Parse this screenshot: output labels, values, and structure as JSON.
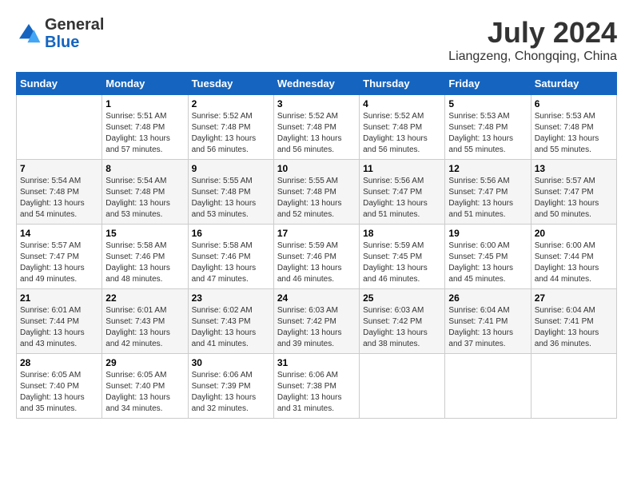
{
  "header": {
    "logo_line1": "General",
    "logo_line2": "Blue",
    "month": "July 2024",
    "location": "Liangzeng, Chongqing, China"
  },
  "weekdays": [
    "Sunday",
    "Monday",
    "Tuesday",
    "Wednesday",
    "Thursday",
    "Friday",
    "Saturday"
  ],
  "weeks": [
    [
      {
        "day": "",
        "sunrise": "",
        "sunset": "",
        "daylight": ""
      },
      {
        "day": "1",
        "sunrise": "Sunrise: 5:51 AM",
        "sunset": "Sunset: 7:48 PM",
        "daylight": "Daylight: 13 hours and 57 minutes."
      },
      {
        "day": "2",
        "sunrise": "Sunrise: 5:52 AM",
        "sunset": "Sunset: 7:48 PM",
        "daylight": "Daylight: 13 hours and 56 minutes."
      },
      {
        "day": "3",
        "sunrise": "Sunrise: 5:52 AM",
        "sunset": "Sunset: 7:48 PM",
        "daylight": "Daylight: 13 hours and 56 minutes."
      },
      {
        "day": "4",
        "sunrise": "Sunrise: 5:52 AM",
        "sunset": "Sunset: 7:48 PM",
        "daylight": "Daylight: 13 hours and 56 minutes."
      },
      {
        "day": "5",
        "sunrise": "Sunrise: 5:53 AM",
        "sunset": "Sunset: 7:48 PM",
        "daylight": "Daylight: 13 hours and 55 minutes."
      },
      {
        "day": "6",
        "sunrise": "Sunrise: 5:53 AM",
        "sunset": "Sunset: 7:48 PM",
        "daylight": "Daylight: 13 hours and 55 minutes."
      }
    ],
    [
      {
        "day": "7",
        "sunrise": "Sunrise: 5:54 AM",
        "sunset": "Sunset: 7:48 PM",
        "daylight": "Daylight: 13 hours and 54 minutes."
      },
      {
        "day": "8",
        "sunrise": "Sunrise: 5:54 AM",
        "sunset": "Sunset: 7:48 PM",
        "daylight": "Daylight: 13 hours and 53 minutes."
      },
      {
        "day": "9",
        "sunrise": "Sunrise: 5:55 AM",
        "sunset": "Sunset: 7:48 PM",
        "daylight": "Daylight: 13 hours and 53 minutes."
      },
      {
        "day": "10",
        "sunrise": "Sunrise: 5:55 AM",
        "sunset": "Sunset: 7:48 PM",
        "daylight": "Daylight: 13 hours and 52 minutes."
      },
      {
        "day": "11",
        "sunrise": "Sunrise: 5:56 AM",
        "sunset": "Sunset: 7:47 PM",
        "daylight": "Daylight: 13 hours and 51 minutes."
      },
      {
        "day": "12",
        "sunrise": "Sunrise: 5:56 AM",
        "sunset": "Sunset: 7:47 PM",
        "daylight": "Daylight: 13 hours and 51 minutes."
      },
      {
        "day": "13",
        "sunrise": "Sunrise: 5:57 AM",
        "sunset": "Sunset: 7:47 PM",
        "daylight": "Daylight: 13 hours and 50 minutes."
      }
    ],
    [
      {
        "day": "14",
        "sunrise": "Sunrise: 5:57 AM",
        "sunset": "Sunset: 7:47 PM",
        "daylight": "Daylight: 13 hours and 49 minutes."
      },
      {
        "day": "15",
        "sunrise": "Sunrise: 5:58 AM",
        "sunset": "Sunset: 7:46 PM",
        "daylight": "Daylight: 13 hours and 48 minutes."
      },
      {
        "day": "16",
        "sunrise": "Sunrise: 5:58 AM",
        "sunset": "Sunset: 7:46 PM",
        "daylight": "Daylight: 13 hours and 47 minutes."
      },
      {
        "day": "17",
        "sunrise": "Sunrise: 5:59 AM",
        "sunset": "Sunset: 7:46 PM",
        "daylight": "Daylight: 13 hours and 46 minutes."
      },
      {
        "day": "18",
        "sunrise": "Sunrise: 5:59 AM",
        "sunset": "Sunset: 7:45 PM",
        "daylight": "Daylight: 13 hours and 46 minutes."
      },
      {
        "day": "19",
        "sunrise": "Sunrise: 6:00 AM",
        "sunset": "Sunset: 7:45 PM",
        "daylight": "Daylight: 13 hours and 45 minutes."
      },
      {
        "day": "20",
        "sunrise": "Sunrise: 6:00 AM",
        "sunset": "Sunset: 7:44 PM",
        "daylight": "Daylight: 13 hours and 44 minutes."
      }
    ],
    [
      {
        "day": "21",
        "sunrise": "Sunrise: 6:01 AM",
        "sunset": "Sunset: 7:44 PM",
        "daylight": "Daylight: 13 hours and 43 minutes."
      },
      {
        "day": "22",
        "sunrise": "Sunrise: 6:01 AM",
        "sunset": "Sunset: 7:43 PM",
        "daylight": "Daylight: 13 hours and 42 minutes."
      },
      {
        "day": "23",
        "sunrise": "Sunrise: 6:02 AM",
        "sunset": "Sunset: 7:43 PM",
        "daylight": "Daylight: 13 hours and 41 minutes."
      },
      {
        "day": "24",
        "sunrise": "Sunrise: 6:03 AM",
        "sunset": "Sunset: 7:42 PM",
        "daylight": "Daylight: 13 hours and 39 minutes."
      },
      {
        "day": "25",
        "sunrise": "Sunrise: 6:03 AM",
        "sunset": "Sunset: 7:42 PM",
        "daylight": "Daylight: 13 hours and 38 minutes."
      },
      {
        "day": "26",
        "sunrise": "Sunrise: 6:04 AM",
        "sunset": "Sunset: 7:41 PM",
        "daylight": "Daylight: 13 hours and 37 minutes."
      },
      {
        "day": "27",
        "sunrise": "Sunrise: 6:04 AM",
        "sunset": "Sunset: 7:41 PM",
        "daylight": "Daylight: 13 hours and 36 minutes."
      }
    ],
    [
      {
        "day": "28",
        "sunrise": "Sunrise: 6:05 AM",
        "sunset": "Sunset: 7:40 PM",
        "daylight": "Daylight: 13 hours and 35 minutes."
      },
      {
        "day": "29",
        "sunrise": "Sunrise: 6:05 AM",
        "sunset": "Sunset: 7:40 PM",
        "daylight": "Daylight: 13 hours and 34 minutes."
      },
      {
        "day": "30",
        "sunrise": "Sunrise: 6:06 AM",
        "sunset": "Sunset: 7:39 PM",
        "daylight": "Daylight: 13 hours and 32 minutes."
      },
      {
        "day": "31",
        "sunrise": "Sunrise: 6:06 AM",
        "sunset": "Sunset: 7:38 PM",
        "daylight": "Daylight: 13 hours and 31 minutes."
      },
      {
        "day": "",
        "sunrise": "",
        "sunset": "",
        "daylight": ""
      },
      {
        "day": "",
        "sunrise": "",
        "sunset": "",
        "daylight": ""
      },
      {
        "day": "",
        "sunrise": "",
        "sunset": "",
        "daylight": ""
      }
    ]
  ]
}
